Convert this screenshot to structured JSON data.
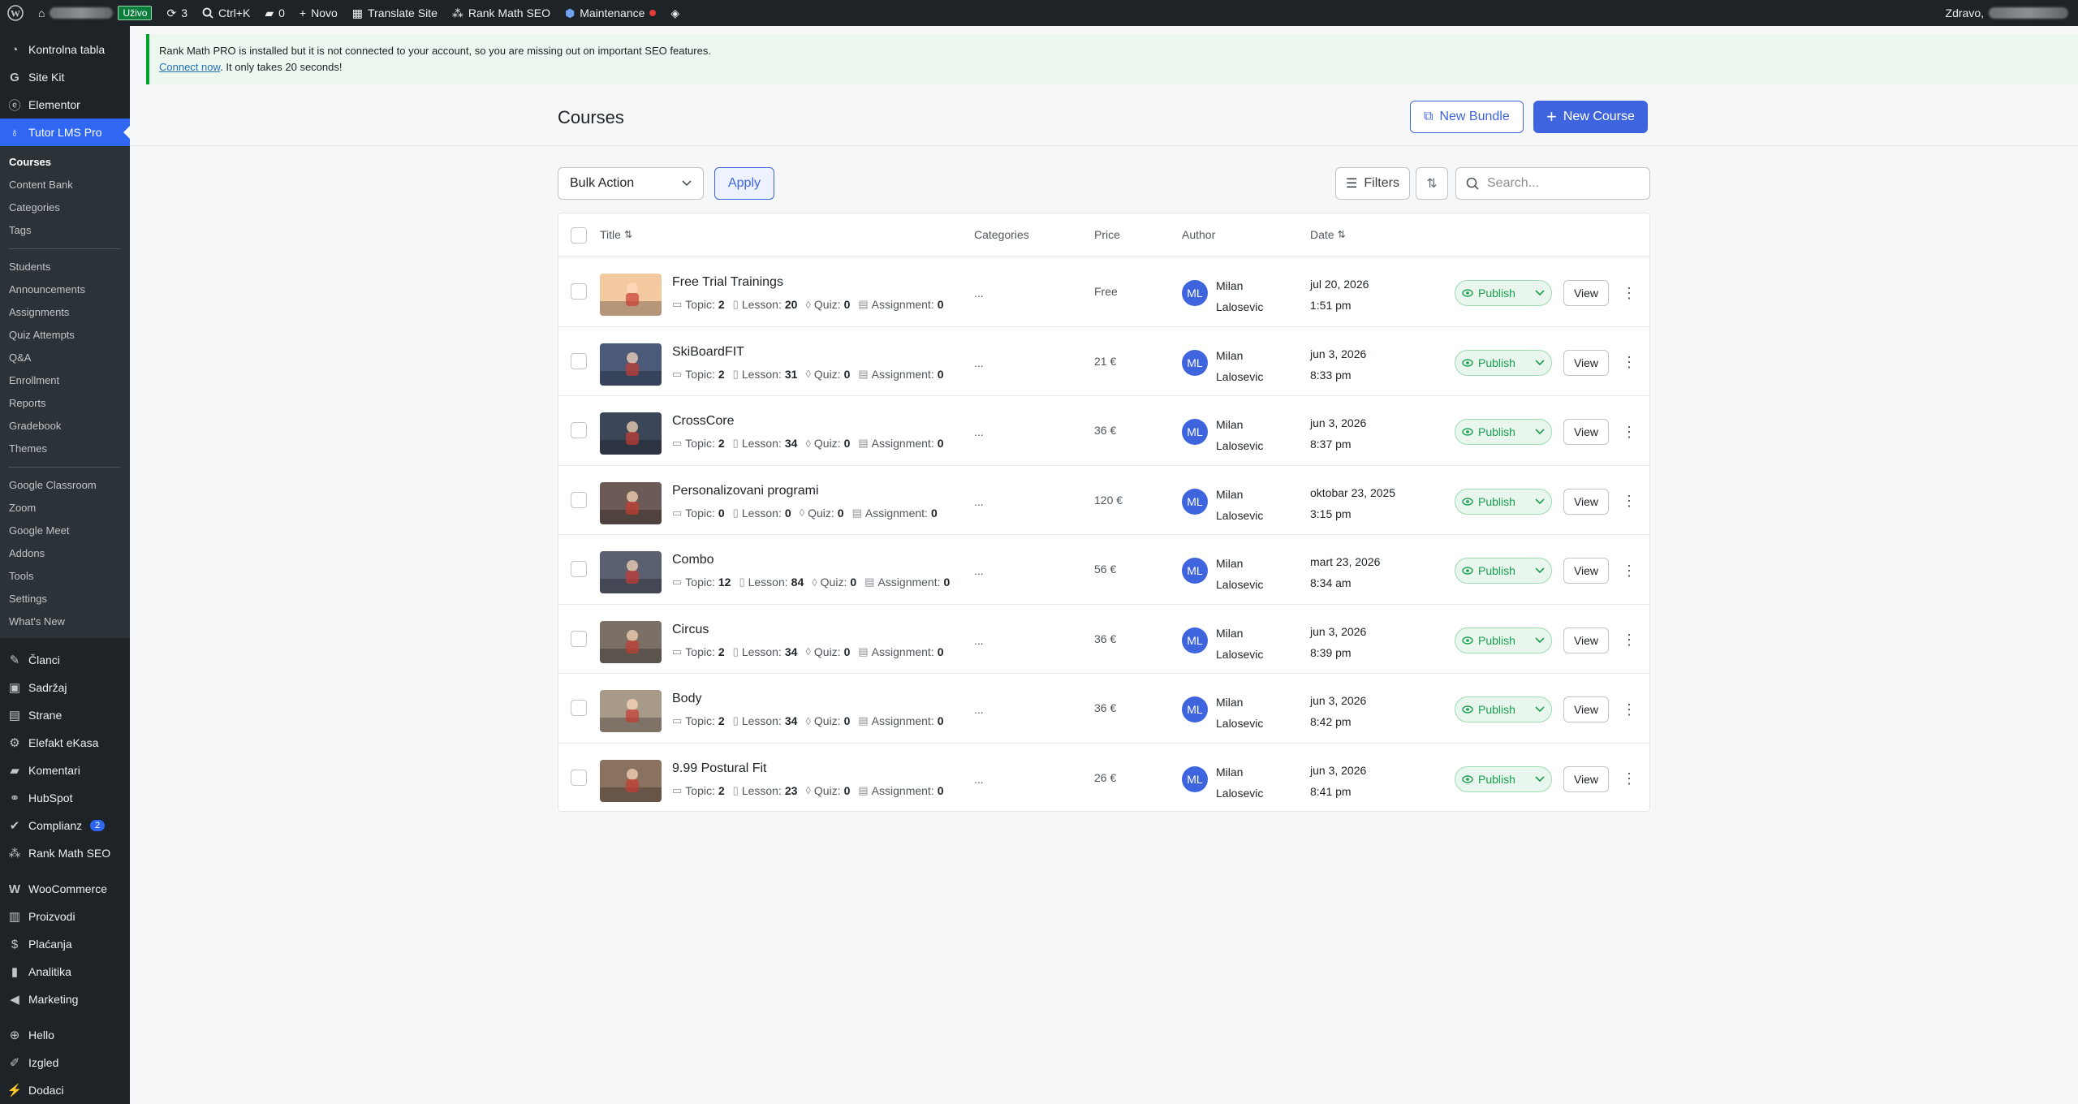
{
  "adminbar": {
    "live_label": "Uživo",
    "updates_count": "3",
    "search_label": "Ctrl+K",
    "comments_count": "0",
    "new_label": "Novo",
    "translate_label": "Translate Site",
    "rankmath_label": "Rank Math SEO",
    "maintenance_label": "Maintenance",
    "greeting": "Zdravo,"
  },
  "sidebar": {
    "top_items": [
      {
        "label": "Kontrolna tabla",
        "icon": "dashboard-icon"
      },
      {
        "label": "Site Kit",
        "icon": "sitekit-icon"
      },
      {
        "label": "Elementor",
        "icon": "elementor-icon"
      },
      {
        "label": "Tutor LMS Pro",
        "icon": "tutor-icon"
      }
    ],
    "submenu_group1": [
      "Courses",
      "Content Bank",
      "Categories",
      "Tags"
    ],
    "submenu_group2": [
      "Students",
      "Announcements",
      "Assignments",
      "Quiz Attempts",
      "Q&A",
      "Enrollment",
      "Reports",
      "Gradebook",
      "Themes"
    ],
    "submenu_group3": [
      "Google Classroom",
      "Zoom",
      "Google Meet",
      "Addons",
      "Tools",
      "Settings",
      "What's New"
    ],
    "bottom_items": [
      {
        "label": "Članci",
        "icon": "pin-icon"
      },
      {
        "label": "Sadržaj",
        "icon": "media-icon"
      },
      {
        "label": "Strane",
        "icon": "page-icon"
      },
      {
        "label": "Elefakt eKasa",
        "icon": "gear-icon"
      },
      {
        "label": "Komentari",
        "icon": "comment-icon"
      },
      {
        "label": "HubSpot",
        "icon": "hubspot-icon"
      },
      {
        "label": "Complianz",
        "icon": "check-icon",
        "badge": "2"
      },
      {
        "label": "Rank Math SEO",
        "icon": "rankmath-icon"
      },
      {
        "label": "WooCommerce",
        "icon": "woo-icon"
      },
      {
        "label": "Proizvodi",
        "icon": "archive-icon"
      },
      {
        "label": "Plaćanja",
        "icon": "dollar-icon"
      },
      {
        "label": "Analitika",
        "icon": "chart-icon"
      },
      {
        "label": "Marketing",
        "icon": "megaphone-icon"
      },
      {
        "label": "Hello",
        "icon": "plus-circle-icon"
      },
      {
        "label": "Izgled",
        "icon": "brush-icon"
      },
      {
        "label": "Dodaci",
        "icon": "plugin-icon"
      }
    ]
  },
  "notice": {
    "text": "Rank Math PRO is installed but it is not connected to your account, so you are missing out on important SEO features.",
    "link": "Connect now",
    "after_link": ". It only takes 20 seconds!"
  },
  "header": {
    "title": "Courses",
    "new_bundle": "New Bundle",
    "new_course": "New Course"
  },
  "toolbar": {
    "bulk_action": "Bulk Action",
    "apply": "Apply",
    "filters": "Filters",
    "search_placeholder": "Search..."
  },
  "table": {
    "columns": {
      "title": "Title",
      "categories": "Categories",
      "price": "Price",
      "author": "Author",
      "date": "Date"
    },
    "meta_labels": {
      "topic": "Topic:",
      "lesson": "Lesson:",
      "quiz": "Quiz:",
      "assignment": "Assignment:"
    },
    "rows": [
      {
        "title": "Free Trial Trainings",
        "topic": "2",
        "lesson": "20",
        "quiz": "0",
        "assignment": "0",
        "categories": "...",
        "price": "Free",
        "initials": "ML",
        "author_first": "Milan",
        "author_last": "Lalosevic",
        "date": "jul 20, 2026",
        "time": "1:51 pm",
        "status": "Publish",
        "view": "View",
        "thumb_color": "#f3c9a0"
      },
      {
        "title": "SkiBoardFIT",
        "topic": "2",
        "lesson": "31",
        "quiz": "0",
        "assignment": "0",
        "categories": "...",
        "price": "21 €",
        "initials": "ML",
        "author_first": "Milan",
        "author_last": "Lalosevic",
        "date": "jun 3, 2026",
        "time": "8:33 pm",
        "status": "Publish",
        "view": "View",
        "thumb_color": "#4a5a78"
      },
      {
        "title": "CrossCore",
        "topic": "2",
        "lesson": "34",
        "quiz": "0",
        "assignment": "0",
        "categories": "...",
        "price": "36 €",
        "initials": "ML",
        "author_first": "Milan",
        "author_last": "Lalosevic",
        "date": "jun 3, 2026",
        "time": "8:37 pm",
        "status": "Publish",
        "view": "View",
        "thumb_color": "#3b4658"
      },
      {
        "title": "Personalizovani programi",
        "topic": "0",
        "lesson": "0",
        "quiz": "0",
        "assignment": "0",
        "categories": "...",
        "price": "120 €",
        "initials": "ML",
        "author_first": "Milan",
        "author_last": "Lalosevic",
        "date": "oktobar 23, 2025",
        "time": "3:15 pm",
        "status": "Publish",
        "view": "View",
        "thumb_color": "#6b5a55"
      },
      {
        "title": "Combo",
        "topic": "12",
        "lesson": "84",
        "quiz": "0",
        "assignment": "0",
        "categories": "...",
        "price": "56 €",
        "initials": "ML",
        "author_first": "Milan",
        "author_last": "Lalosevic",
        "date": "mart 23, 2026",
        "time": "8:34 am",
        "status": "Publish",
        "view": "View",
        "thumb_color": "#5a6070"
      },
      {
        "title": "Circus",
        "topic": "2",
        "lesson": "34",
        "quiz": "0",
        "assignment": "0",
        "categories": "...",
        "price": "36 €",
        "initials": "ML",
        "author_first": "Milan",
        "author_last": "Lalosevic",
        "date": "jun 3, 2026",
        "time": "8:39 pm",
        "status": "Publish",
        "view": "View",
        "thumb_color": "#7a7066"
      },
      {
        "title": "Body",
        "topic": "2",
        "lesson": "34",
        "quiz": "0",
        "assignment": "0",
        "categories": "...",
        "price": "36 €",
        "initials": "ML",
        "author_first": "Milan",
        "author_last": "Lalosevic",
        "date": "jun 3, 2026",
        "time": "8:42 pm",
        "status": "Publish",
        "view": "View",
        "thumb_color": "#a89a88"
      },
      {
        "title": "9.99 Postural Fit",
        "topic": "2",
        "lesson": "23",
        "quiz": "0",
        "assignment": "0",
        "categories": "...",
        "price": "26 €",
        "initials": "ML",
        "author_first": "Milan",
        "author_last": "Lalosevic",
        "date": "jun 3, 2026",
        "time": "8:41 pm",
        "status": "Publish",
        "view": "View",
        "thumb_color": "#8a7260"
      }
    ]
  }
}
